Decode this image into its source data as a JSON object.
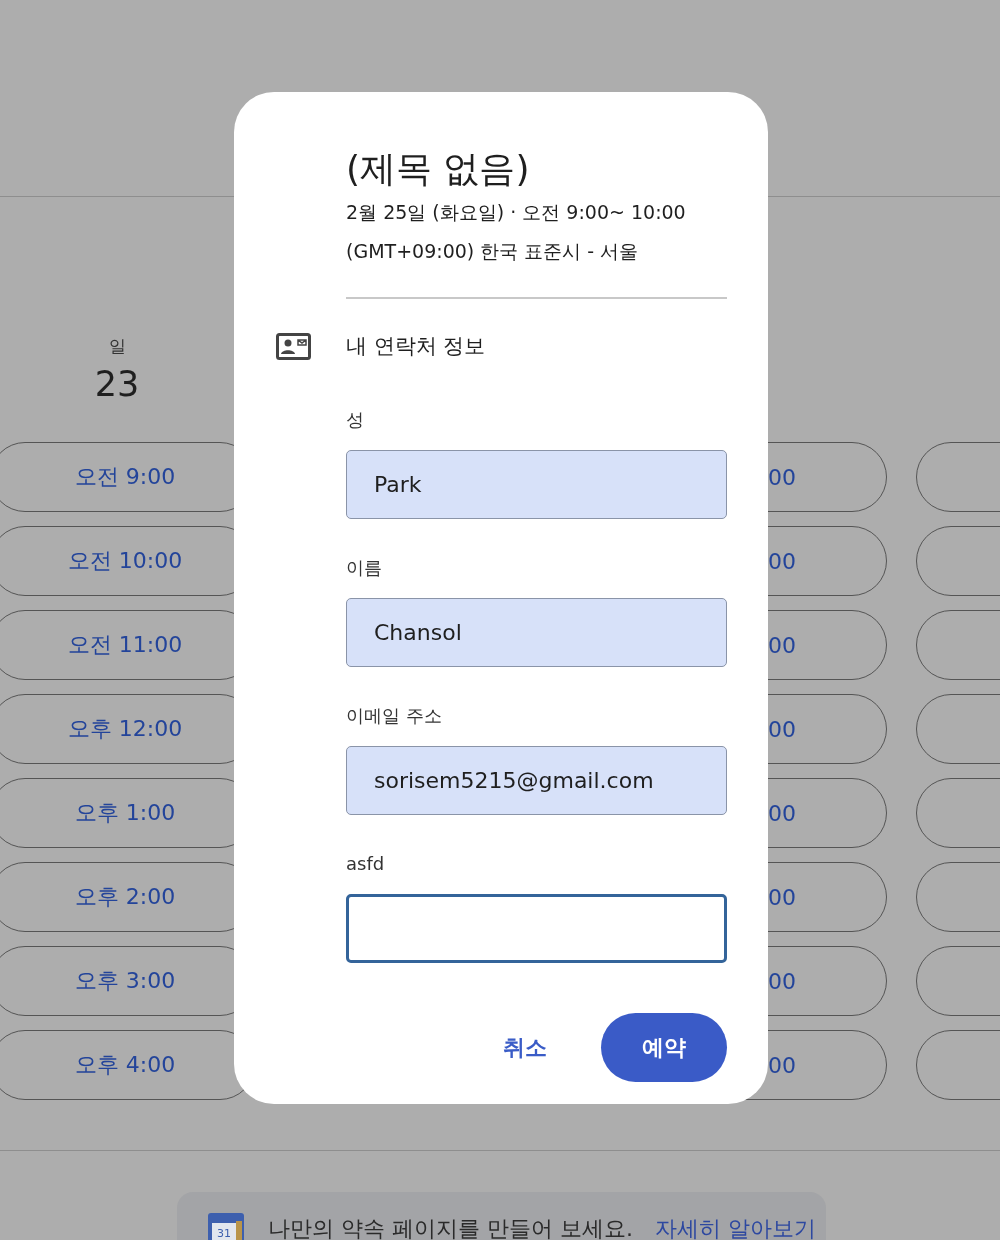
{
  "calendar": {
    "day": {
      "weekday": "일",
      "date": "23"
    },
    "slot_columns": [
      {
        "slots": [
          "오전 9:00",
          "오전 10:00",
          "오전 11:00",
          "오후 12:00",
          "오후 1:00",
          "오후 2:00",
          "오후 3:00",
          "오후 4:00"
        ]
      },
      {
        "slots": [
          "00",
          "00",
          "00",
          "00",
          "00",
          "00",
          "00",
          "00"
        ]
      }
    ],
    "banner": {
      "icon_label": "31",
      "text": "나만의 약속 페이지를 만들어 보세요.",
      "link": "자세히 알아보기"
    }
  },
  "dialog": {
    "title": "(제목 없음)",
    "date": "2월 25일 (화요일) · 오전 9:00~ 10:00",
    "timezone": "(GMT+09:00) 한국 표준시 - 서울",
    "section": "내 연락처 정보",
    "fields": [
      {
        "label": "성",
        "value": "Park",
        "focused": false
      },
      {
        "label": "이름",
        "value": "Chansol",
        "focused": false
      },
      {
        "label": "이메일 주소",
        "value": "sorisem5215@gmail.com",
        "focused": false
      },
      {
        "label": "asfd",
        "focused": true
      }
    ],
    "buttons": [
      {
        "label": "취소",
        "kind": "text"
      },
      {
        "label": "예약",
        "kind": "filled"
      }
    ]
  }
}
